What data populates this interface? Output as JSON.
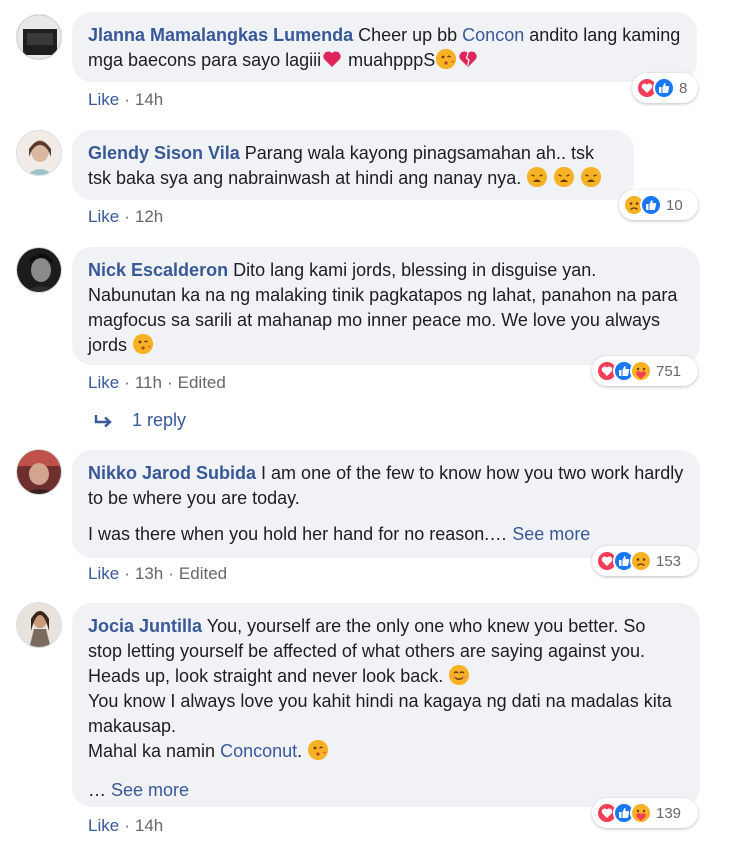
{
  "comments": [
    {
      "author": "Jlanna Mamalangkas Lumenda",
      "text_a": " Cheer up bb ",
      "mention": "Concon",
      "text_b": " andito lang kaming mga baecons para sayo lagiii",
      "text_c": " muahpppS",
      "like_label": "Like",
      "time": "14h",
      "reaction_count": "8",
      "reactions": [
        "love-reaction-icon",
        "like-reaction-icon"
      ]
    },
    {
      "author": "Glendy Sison Vila",
      "text": " Parang wala kayong pinagsamahan ah.. tsk tsk baka sya ang nabrainwash at hindi ang nanay nya.",
      "like_label": "Like",
      "time": "12h",
      "reaction_count": "10",
      "reactions": [
        "sad-reaction-icon",
        "like-reaction-icon"
      ]
    },
    {
      "author": "Nick Escalderon",
      "text": " Dito lang kami jords, blessing in disguise yan. Nabunutan ka na ng malaking tinik pagkatapos ng lahat, panahon na para magfocus sa sarili at mahanap mo inner peace mo. We love you always jords",
      "like_label": "Like",
      "time": "11h",
      "edited": "Edited",
      "reaction_count": "751",
      "reactions": [
        "love-reaction-icon",
        "like-reaction-icon",
        "care-reaction-icon"
      ],
      "reply_label": "1 reply"
    },
    {
      "author": "Nikko Jarod Subida",
      "text": " I am one of the few to know how you two work hardly to be where you are today.",
      "text2": "I was there when you hold her hand for no reason.…",
      "see_more": "See more",
      "like_label": "Like",
      "time": "13h",
      "edited": "Edited",
      "reaction_count": "153",
      "reactions": [
        "love-reaction-icon",
        "like-reaction-icon",
        "sad-reaction-icon"
      ]
    },
    {
      "author": "Jocia Juntilla",
      "text": " You, yourself are the only one who knew you better. So stop letting yourself be affected of what others are saying against you. Heads up, look straight and never look back.",
      "line2": "You know I always love you kahit hindi na kagaya ng dati na madalas kita makausap.",
      "line3a": "Mahal ka namin ",
      "mention": "Conconut",
      "line3b": ".",
      "see_more_prefix": "… ",
      "see_more": "See more",
      "like_label": "Like",
      "time": "14h",
      "reaction_count": "139",
      "reactions": [
        "love-reaction-icon",
        "like-reaction-icon",
        "care-reaction-icon"
      ]
    }
  ],
  "colors": {
    "link": "#385898",
    "bubble": "#f0f2f5",
    "meta": "#65676b",
    "love": "#f33e58",
    "like": "#1877f2",
    "emoji": "#f7b125"
  }
}
